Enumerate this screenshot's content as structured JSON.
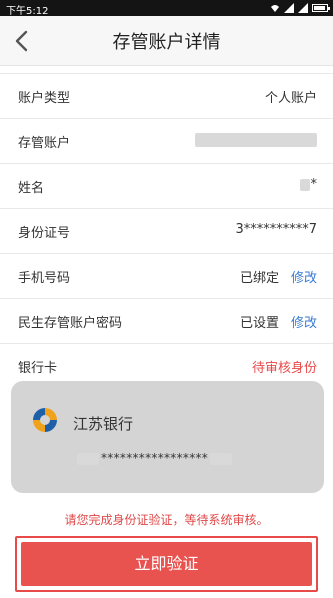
{
  "status_bar": {
    "time": "下午5:12"
  },
  "header": {
    "title": "存管账户详情"
  },
  "rows": [
    {
      "label": "账户类型",
      "value": "个人账户"
    },
    {
      "label": "存管账户",
      "value": ""
    },
    {
      "label": "姓名",
      "value": "*"
    },
    {
      "label": "身份证号",
      "value": "3**********7"
    },
    {
      "label": "手机号码",
      "value": "已绑定",
      "action": "修改"
    },
    {
      "label": "民生存管账户密码",
      "value": "已设置",
      "action": "修改"
    },
    {
      "label": "银行卡",
      "value": "待审核身份"
    }
  ],
  "bank_card": {
    "bank_name": "江苏银行",
    "card_number": "*****************"
  },
  "notice": "请您完成身份证验证，等待系统审核。",
  "verify_button": "立即验证",
  "colors": {
    "accent_red": "#e84a4a",
    "link_blue": "#3a7bd5"
  },
  "icons": {
    "back": "chevron-left-icon",
    "bank_logo": "jiangsu-bank-logo-icon"
  }
}
